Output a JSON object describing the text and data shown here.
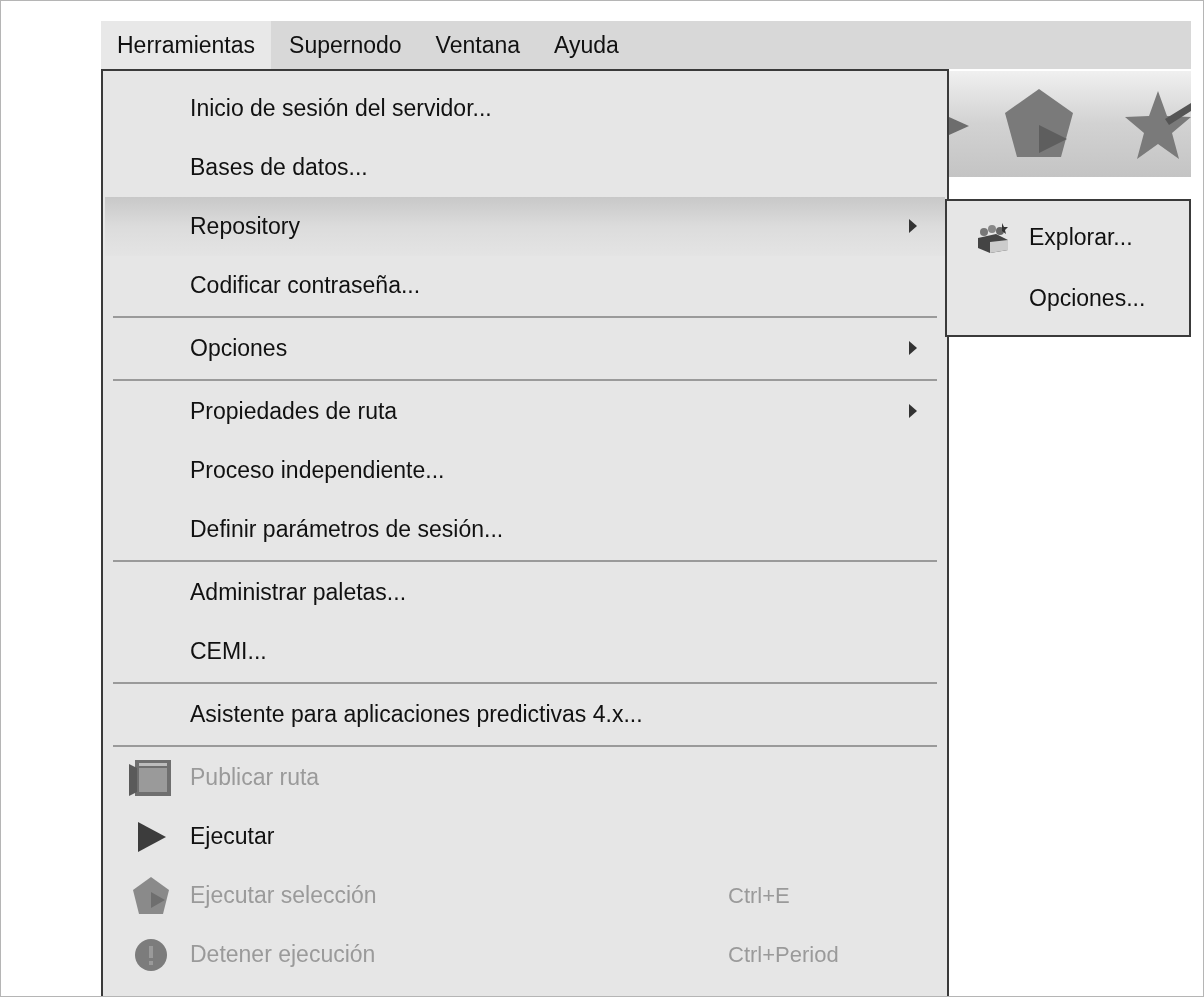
{
  "menubar": [
    {
      "label": "Herramientas",
      "selected": true
    },
    {
      "label": "Supernodo",
      "selected": false
    },
    {
      "label": "Ventana",
      "selected": false
    },
    {
      "label": "Ayuda",
      "selected": false
    }
  ],
  "menu": {
    "groups": [
      [
        {
          "label": "Inicio de sesión del servidor...",
          "kind": "plain",
          "selected": false,
          "disabled": false
        },
        {
          "label": "Bases de datos...",
          "kind": "plain",
          "selected": false,
          "disabled": false
        },
        {
          "label": "Repository",
          "kind": "submenu",
          "selected": true,
          "disabled": false
        },
        {
          "label": "Codificar contraseña...",
          "kind": "plain",
          "selected": false,
          "disabled": false
        }
      ],
      [
        {
          "label": "Opciones",
          "kind": "submenu",
          "selected": false,
          "disabled": false
        }
      ],
      [
        {
          "label": "Propiedades de ruta",
          "kind": "submenu",
          "selected": false,
          "disabled": false
        },
        {
          "label": "Proceso independiente...",
          "kind": "plain",
          "selected": false,
          "disabled": false
        },
        {
          "label": "Definir parámetros de sesión...",
          "kind": "plain",
          "selected": false,
          "disabled": false
        }
      ],
      [
        {
          "label": "Administrar paletas...",
          "kind": "plain",
          "selected": false,
          "disabled": false
        },
        {
          "label": "CEMI...",
          "kind": "plain",
          "selected": false,
          "disabled": false
        }
      ],
      [
        {
          "label": "Asistente para aplicaciones predictivas 4.x...",
          "kind": "plain",
          "selected": false,
          "disabled": false
        }
      ],
      [
        {
          "label": "Publicar ruta",
          "kind": "publish",
          "selected": false,
          "disabled": true
        },
        {
          "label": "Ejecutar",
          "kind": "run",
          "selected": false,
          "disabled": false
        },
        {
          "label": "Ejecutar selección",
          "kind": "run_selection",
          "selected": false,
          "disabled": true,
          "shortcut": "Ctrl+E"
        },
        {
          "label": "Detener ejecución",
          "kind": "stop",
          "selected": false,
          "disabled": true,
          "shortcut": "Ctrl+Period"
        }
      ]
    ]
  },
  "submenu": {
    "items": [
      {
        "label": "Explorar...",
        "kind": "explore",
        "selected": false
      },
      {
        "label": "Opciones...",
        "kind": "plain",
        "selected": false
      }
    ]
  }
}
